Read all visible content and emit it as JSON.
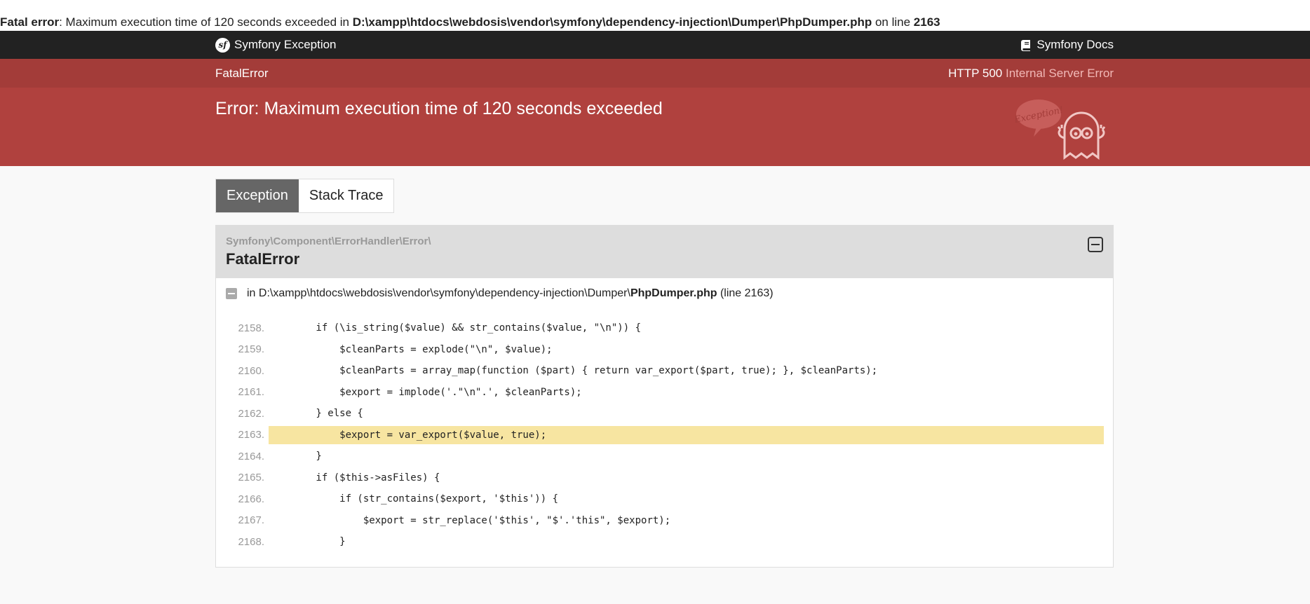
{
  "php_error": {
    "label": "Fatal error",
    "message": ": Maximum execution time of 120 seconds exceeded in ",
    "path": "D:\\xampp\\htdocs\\webdosis\\vendor\\symfony\\dependency-injection\\Dumper\\PhpDumper.php",
    "on_line": " on line ",
    "line": "2163"
  },
  "topbar": {
    "brand": "Symfony Exception",
    "docs": "Symfony Docs"
  },
  "header": {
    "exception_class": "FatalError",
    "status_code": "HTTP 500",
    "status_text": "Internal Server Error",
    "title": "Error: Maximum execution time of 120 seconds exceeded",
    "ghost_bubble": "Exception!"
  },
  "tabs": [
    {
      "label": "Exception",
      "active": true
    },
    {
      "label": "Stack Trace",
      "active": false
    }
  ],
  "exception": {
    "namespace": "Symfony\\Component\\ErrorHandler\\Error\\",
    "class": "FatalError",
    "file_prefix": "in D:\\xampp\\htdocs\\webdosis\\vendor\\symfony\\dependency-injection\\Dumper\\",
    "file_name": "PhpDumper.php",
    "file_line": "(line 2163)"
  },
  "code_lines": [
    {
      "n": "2158.",
      "code": "        if (\\is_string($value) && str_contains($value, \"\\n\")) {"
    },
    {
      "n": "2159.",
      "code": "            $cleanParts = explode(\"\\n\", $value);"
    },
    {
      "n": "2160.",
      "code": "            $cleanParts = array_map(function ($part) { return var_export($part, true); }, $cleanParts);"
    },
    {
      "n": "2161.",
      "code": "            $export = implode('.\"\\n\".', $cleanParts);"
    },
    {
      "n": "2162.",
      "code": "        } else {"
    },
    {
      "n": "2163.",
      "code": "            $export = var_export($value, true);"
    },
    {
      "n": "2164.",
      "code": "        }"
    },
    {
      "n": "2165.",
      "code": "        if ($this->asFiles) {"
    },
    {
      "n": "2166.",
      "code": "            if (str_contains($export, '$this')) {"
    },
    {
      "n": "2167.",
      "code": "                $export = str_replace('$this', \"$'.'this\", $export);"
    },
    {
      "n": "2168.",
      "code": "            }"
    }
  ],
  "selected_line": "2163.",
  "colors": {
    "header_red": "#b0413e",
    "header_meta": "#a33c39",
    "topbar": "#222222",
    "highlight": "#f7e5a1",
    "tab_active": "#666666"
  }
}
